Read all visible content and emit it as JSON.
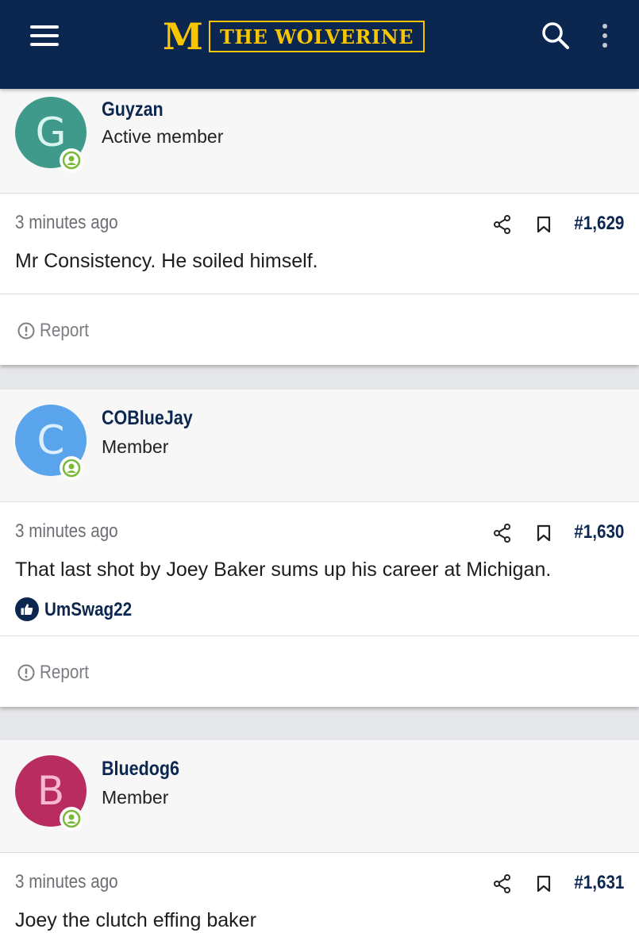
{
  "header": {
    "logo_letter": "M",
    "logo_text": "THE WOLVERINE",
    "background": "#0b2750",
    "accent": "#f7c600"
  },
  "posts": [
    {
      "username": "Guyzan",
      "user_title": "Active member",
      "avatar_letter": "G",
      "avatar_bg": "#3f9a8b",
      "avatar_fg": "#d7f5ee",
      "time": "3 minutes ago",
      "post_number": "#1,629",
      "message": "Mr Consistency. He soiled himself.",
      "report_label": "Report"
    },
    {
      "username": "COBlueJay",
      "user_title": "Member",
      "avatar_letter": "C",
      "avatar_bg": "#5aa4ec",
      "avatar_fg": "#dcefff",
      "time": "3 minutes ago",
      "post_number": "#1,630",
      "message": "That last shot by Joey Baker sums up his career at Michigan.",
      "reaction_user": "UmSwag22",
      "report_label": "Report"
    },
    {
      "username": "Bluedog6",
      "user_title": "Member",
      "avatar_letter": "B",
      "avatar_bg": "#b92c5f",
      "avatar_fg": "#f7b8cf",
      "time": "3 minutes ago",
      "post_number": "#1,631",
      "message": "Joey the clutch effing baker"
    }
  ]
}
